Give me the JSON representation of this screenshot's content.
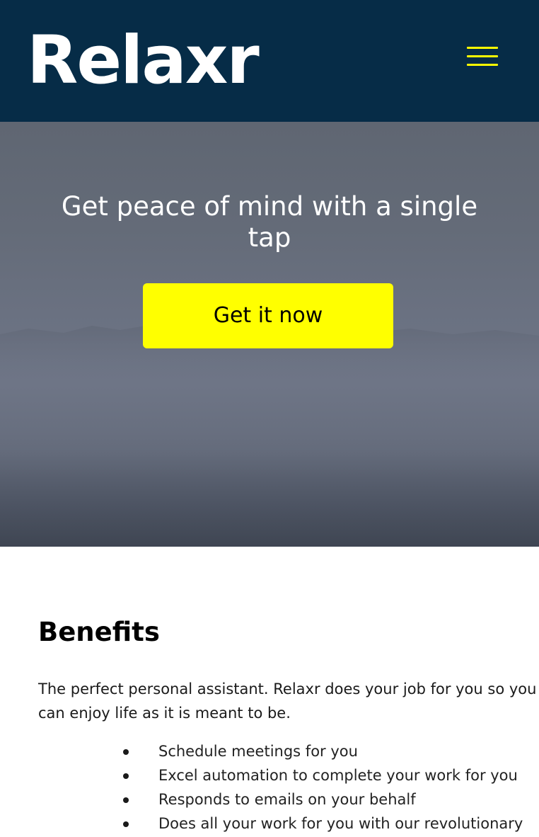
{
  "header": {
    "logo_text": "Relaxr",
    "menu_icon": "hamburger-menu-icon",
    "background_color": "#062c47",
    "accent_color": "#ffff00"
  },
  "hero": {
    "title": "Get peace of mind with a single tap",
    "cta_label": "Get it now",
    "cta_color": "#ffff00"
  },
  "benefits": {
    "title": "Benefits",
    "intro": "The perfect personal assistant. Relaxr does your job for you so you can enjoy life as it is meant to be.",
    "items": [
      "Schedule meetings for you",
      "Excel automation to complete your work for you",
      "Responds to emails on your behalf",
      "Does all your work for you with our revolutionary"
    ]
  }
}
